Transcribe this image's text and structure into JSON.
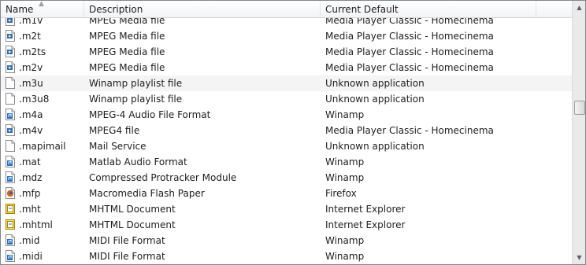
{
  "columns": {
    "name": "Name",
    "description": "Description",
    "current_default": "Current Default"
  },
  "sort_indicator": "▲",
  "scrollbar": {
    "up_arrow": "▲",
    "down_arrow": "▼"
  },
  "rows": [
    {
      "name": ".m1v",
      "description": "MPEG Media file",
      "default": "Media Player Classic - Homecinema",
      "icon": "media-player-file-icon"
    },
    {
      "name": ".m2t",
      "description": "MPEG Media file",
      "default": "Media Player Classic - Homecinema",
      "icon": "media-player-file-icon"
    },
    {
      "name": ".m2ts",
      "description": "MPEG Media file",
      "default": "Media Player Classic - Homecinema",
      "icon": "media-player-file-icon"
    },
    {
      "name": ".m2v",
      "description": "MPEG Media file",
      "default": "Media Player Classic - Homecinema",
      "icon": "media-player-file-icon"
    },
    {
      "name": ".m3u",
      "description": "Winamp playlist file",
      "default": "Unknown application",
      "icon": "blank-file-icon"
    },
    {
      "name": ".m3u8",
      "description": "Winamp playlist file",
      "default": "Unknown application",
      "icon": "blank-file-icon"
    },
    {
      "name": ".m4a",
      "description": "MPEG-4 Audio File Format",
      "default": "Winamp",
      "icon": "winamp-file-icon"
    },
    {
      "name": ".m4v",
      "description": "MPEG4 file",
      "default": "Media Player Classic - Homecinema",
      "icon": "media-player-file-icon"
    },
    {
      "name": ".mapimail",
      "description": "Mail Service",
      "default": "Unknown application",
      "icon": "blank-file-icon"
    },
    {
      "name": ".mat",
      "description": "Matlab Audio Format",
      "default": "Winamp",
      "icon": "winamp-file-icon"
    },
    {
      "name": ".mdz",
      "description": "Compressed Protracker Module",
      "default": "Winamp",
      "icon": "winamp-file-icon"
    },
    {
      "name": ".mfp",
      "description": "Macromedia Flash Paper",
      "default": "Firefox",
      "icon": "firefox-file-icon"
    },
    {
      "name": ".mht",
      "description": "MHTML Document",
      "default": "Internet Explorer",
      "icon": "ie-file-icon"
    },
    {
      "name": ".mhtml",
      "description": "MHTML Document",
      "default": "Internet Explorer",
      "icon": "ie-file-icon"
    },
    {
      "name": ".mid",
      "description": "MIDI File Format",
      "default": "Winamp",
      "icon": "winamp-file-icon"
    },
    {
      "name": ".midi",
      "description": "MIDI File Format",
      "default": "Winamp",
      "icon": "winamp-file-icon"
    }
  ],
  "hover_row": 4,
  "colors": {
    "hover": "#f4f4f4",
    "border": "#828790",
    "icon_blue": "#2a6fc0",
    "firefox_orange": "#e0661b",
    "ie_gold": "#d9b000"
  }
}
